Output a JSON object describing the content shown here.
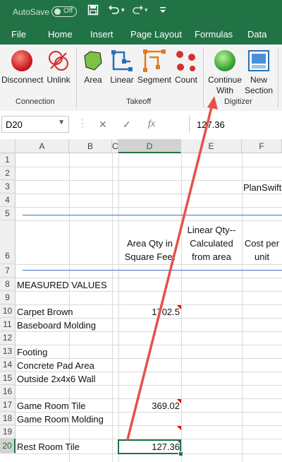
{
  "titlebar": {
    "autosave_label": "AutoSave",
    "autosave_state": "Off"
  },
  "menu": [
    "File",
    "Home",
    "Insert",
    "Page Layout",
    "Formulas",
    "Data"
  ],
  "ribbon": {
    "connection": {
      "disconnect": "Disconnect",
      "unlink": "Unlink",
      "group": "Connection"
    },
    "takeoff": {
      "area": "Area",
      "linear": "Linear",
      "segment": "Segment",
      "count": "Count",
      "group": "Takeoff"
    },
    "digitizer": {
      "continue_line1": "Continue",
      "continue_line2": "With",
      "newsec_line1": "New",
      "newsec_line2": "Section",
      "group": "Digitizer"
    }
  },
  "formula_bar": {
    "name_box": "D20",
    "fx": "fx",
    "value": "127.36"
  },
  "columns": [
    "A",
    "B",
    "C",
    "D",
    "E",
    "F"
  ],
  "rows": [
    "1",
    "2",
    "3",
    "4",
    "5",
    "6",
    "7",
    "8",
    "9",
    "10",
    "11",
    "12",
    "13",
    "14",
    "15",
    "16",
    "17",
    "18",
    "19",
    "20"
  ],
  "cells": {
    "F3": "PlanSwift",
    "D6": [
      "Area Qty in",
      "Square Feet"
    ],
    "E6": [
      "Linear Qty--",
      "Calculated",
      "from area"
    ],
    "F6": [
      "Cost per",
      "unit"
    ],
    "A8": "MEASURED VALUES",
    "A10": "Carpet Brown",
    "D10": "1702.5",
    "A11": "Baseboard Molding",
    "A13": "Footing",
    "A14": "Concrete Pad Area",
    "A15": "Outside 2x4x6 Wall",
    "A17": "Game Room Tile",
    "D17": "369.02",
    "A18": "Game Room Molding",
    "A20": "Rest Room Tile",
    "D20": "127.36"
  },
  "colors": {
    "excel_green": "#217346",
    "arrow_red": "#e8504a",
    "border_blue": "#4472c4"
  }
}
